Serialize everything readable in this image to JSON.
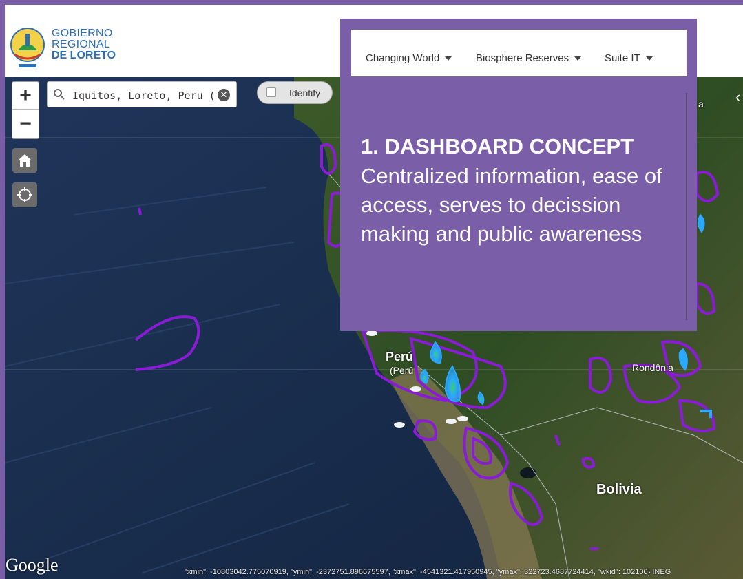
{
  "logo": {
    "line1": "GOBIERNO",
    "line2": "REGIONAL",
    "line3": "DE LORETO",
    "seal_text": "GOBIERNO REGIONAL LORETO"
  },
  "nav": {
    "items": [
      {
        "label": "Changing World"
      },
      {
        "label": "Biosphere Reserves"
      },
      {
        "label": "Suite IT"
      }
    ]
  },
  "search": {
    "value": "Iquitos, Loreto, Peru (State",
    "icon": "search-icon",
    "clear_icon": "close-icon"
  },
  "identify": {
    "label": "Identify",
    "checked": false
  },
  "zoom": {
    "in_label": "+",
    "out_label": "−"
  },
  "concept": {
    "title": "1.  DASHBOARD CONCEPT",
    "body": "Centralized information, ease of access, serves to decission making and public awareness"
  },
  "map": {
    "labels": {
      "peru": "Perú",
      "peru_sub": "(Perú",
      "rondonia": "Rondônia",
      "bolivia": "Bolivia",
      "edge_a": "a"
    },
    "attribution": "Google",
    "extent_text": "\"xmin\": -10803042.775070919, \"ymin\": -2372751.896675597, \"xmax\": -4541321.417950945, \"ymax\": 322723.4687724414, \"wkid\": 102100} INEG",
    "colors": {
      "contour_outer": "#8a1bd6",
      "contour_mid": "#2aa9ff",
      "contour_core": "#39d06a",
      "ocean": "#1b2f4e",
      "land": "#3f5a2a"
    }
  },
  "theme": {
    "purple": "#7b5ea8",
    "logo_blue": "#2d6fb7"
  }
}
